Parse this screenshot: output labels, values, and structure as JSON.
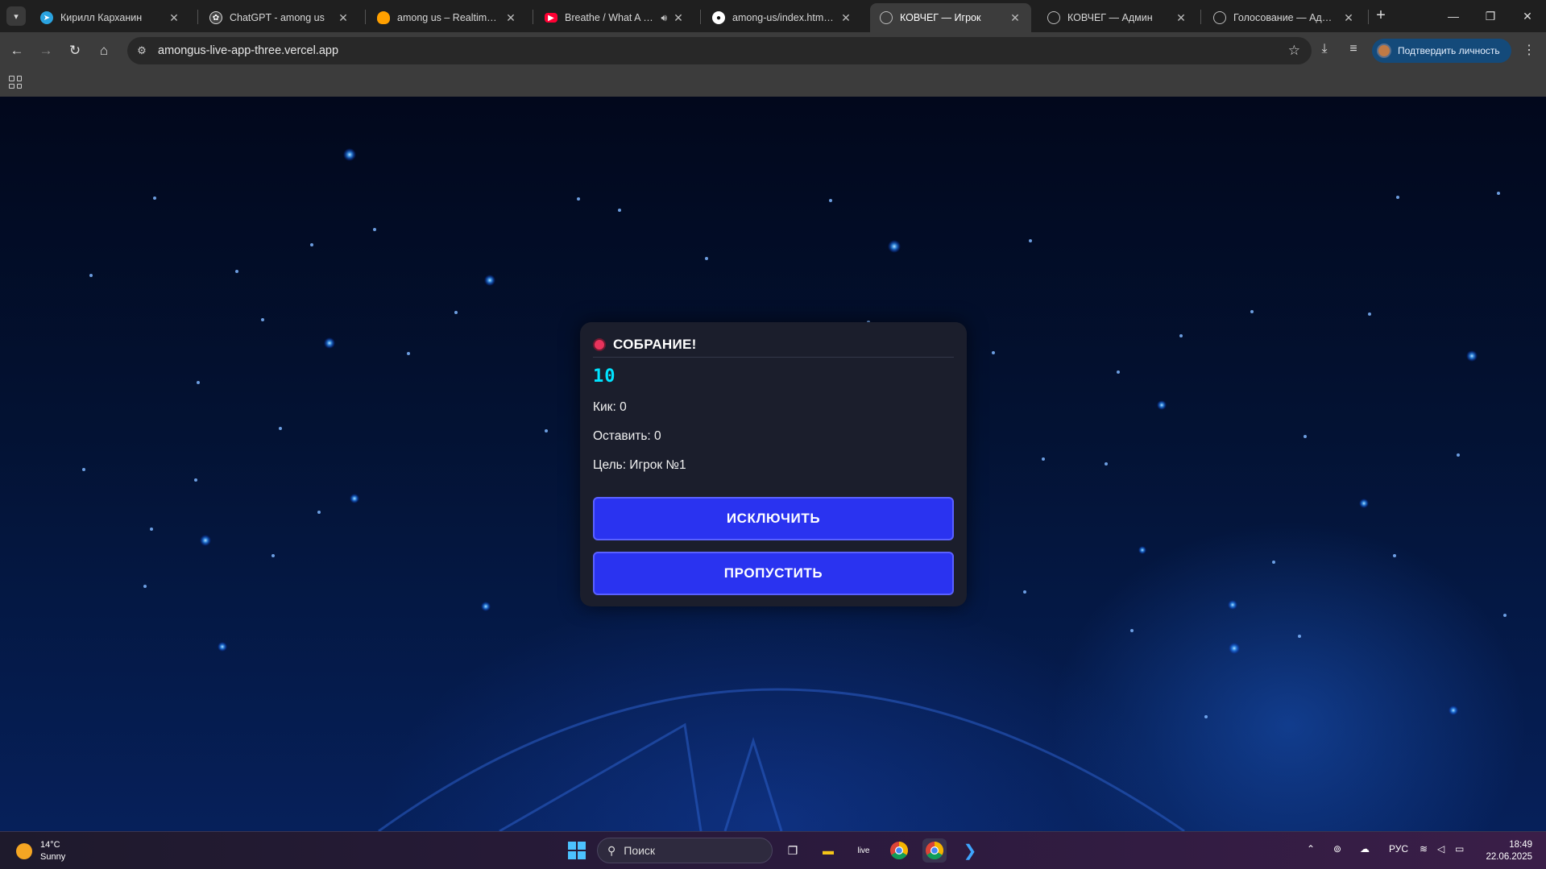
{
  "browser": {
    "tabs": [
      {
        "title": "Кирилл Карханин",
        "icon": "telegram-icon",
        "color": "#2aa3e0"
      },
      {
        "title": "ChatGPT - among us",
        "icon": "chatgpt-icon",
        "color": "#ffffff"
      },
      {
        "title": "among us – Realtime Data",
        "icon": "firebase-icon",
        "color": "#ffa000"
      },
      {
        "title": "Breathe / What A Frie",
        "icon": "youtube-icon",
        "color": "#ff0033"
      },
      {
        "title": "among-us/index.html at m",
        "icon": "github-icon",
        "color": "#ffffff"
      },
      {
        "title": "КОВЧЕГ — Игрок",
        "icon": "globe-icon",
        "color": "#bbbbbb"
      },
      {
        "title": "КОВЧЕГ — Админ",
        "icon": "globe-icon",
        "color": "#bbbbbb"
      },
      {
        "title": "Голосование — Админ",
        "icon": "globe-icon",
        "color": "#bbbbbb"
      }
    ],
    "url": "amongus-live-app-three.vercel.app",
    "verify_label": "Подтвердить личность"
  },
  "meeting": {
    "title": "СОБРАНИЕ!",
    "timer": "10",
    "kick_line": "Кик: 0",
    "keep_line": "Оставить: 0",
    "target_line": "Цель: Игрок №1",
    "kick_button": "ИСКЛЮЧИТЬ",
    "skip_button": "ПРОПУСТИТЬ",
    "accent_color": "#2a33f0",
    "timer_color": "#00e3ff",
    "dot_color": "#e8335c"
  },
  "taskbar": {
    "weather_temp": "14°C",
    "weather_desc": "Sunny",
    "search_placeholder": "Поиск",
    "language": "РУС",
    "time": "18:49",
    "date": "22.06.2025"
  }
}
